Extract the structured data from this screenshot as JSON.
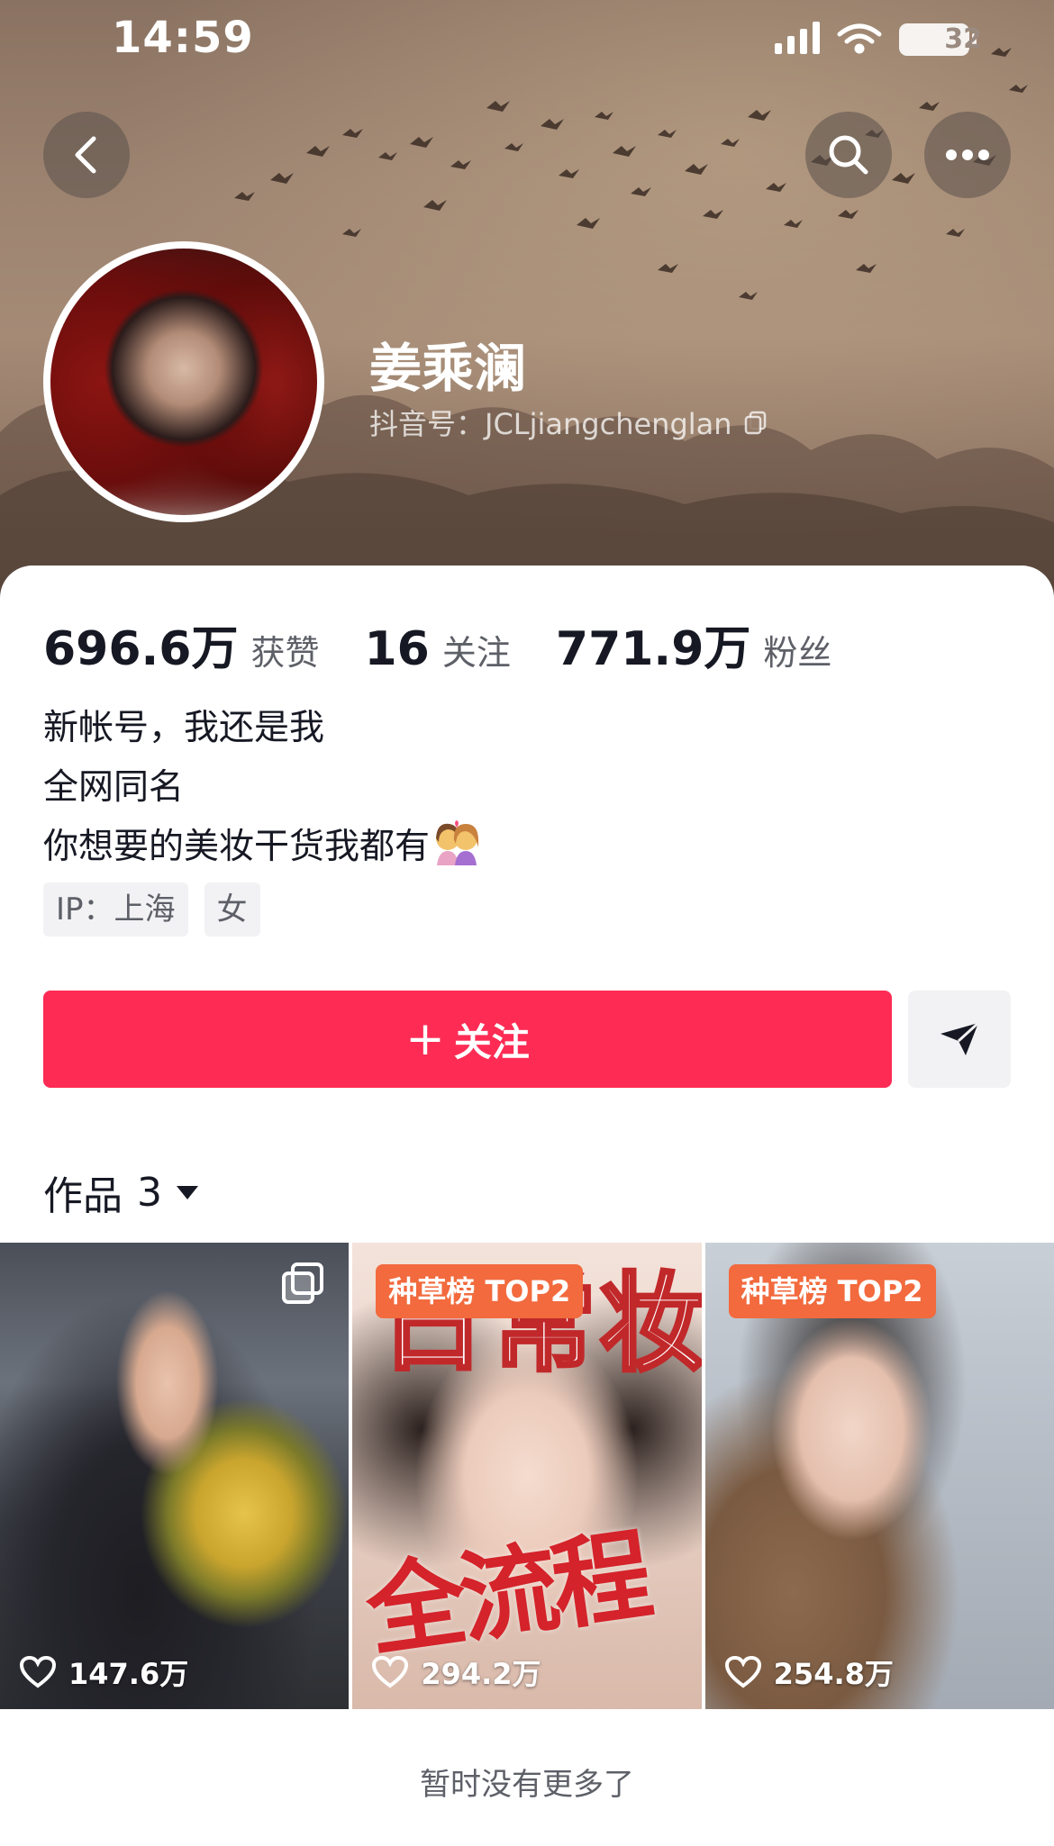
{
  "status_bar": {
    "time": "14:59",
    "battery": "32"
  },
  "profile": {
    "name": "姜乘澜",
    "douyin_id": "抖音号：JCLjiangchenglan"
  },
  "stats": [
    {
      "value": "696.6万",
      "label": "获赞"
    },
    {
      "value": "16",
      "label": "关注"
    },
    {
      "value": "771.9万",
      "label": "粉丝"
    }
  ],
  "bio": {
    "line1": "新帐号，我还是我",
    "line2": "全网同名",
    "line3": "你想要的美妆干货我都有"
  },
  "tags": {
    "ip": "IP：上海",
    "gender": "女"
  },
  "actions": {
    "follow_plus": "+",
    "follow_label": "关注"
  },
  "works": {
    "label": "作品",
    "count": "3",
    "items": [
      {
        "likes": "147.6万",
        "badge": ""
      },
      {
        "likes": "294.2万",
        "badge": "种草榜 TOP2",
        "title": "日常妆",
        "overlay": "全流程"
      },
      {
        "likes": "254.8万",
        "badge": "种草榜 TOP2"
      }
    ]
  },
  "footer": {
    "no_more": "暂时没有更多了"
  },
  "colors": {
    "accent": "#fe2c55",
    "badge": "#f26a3d"
  },
  "icons": [
    "back-icon",
    "search-icon",
    "more-icon",
    "copy-icon",
    "share-icon",
    "dropdown-icon",
    "heart-icon",
    "multi-image-icon"
  ]
}
